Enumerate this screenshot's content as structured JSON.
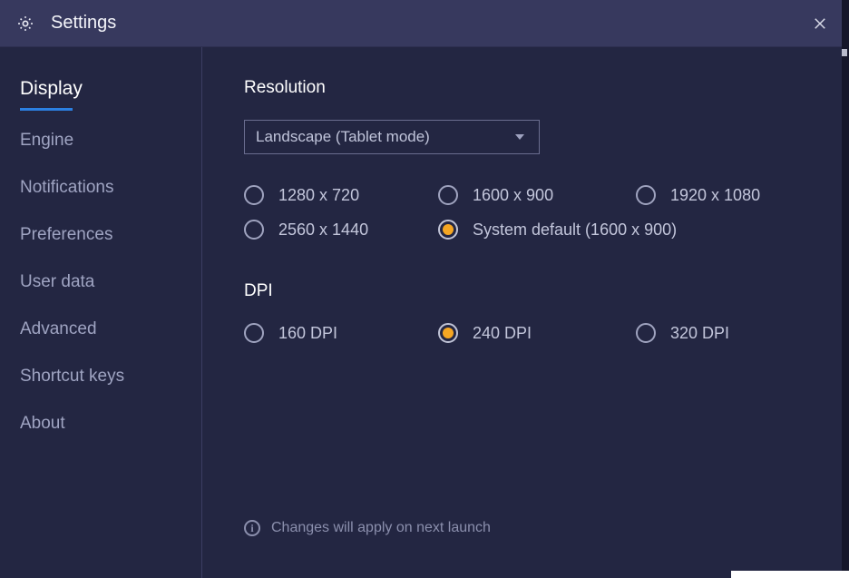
{
  "titlebar": {
    "title": "Settings"
  },
  "sidebar": {
    "items": [
      {
        "label": "Display",
        "active": true
      },
      {
        "label": "Engine",
        "active": false
      },
      {
        "label": "Notifications",
        "active": false
      },
      {
        "label": "Preferences",
        "active": false
      },
      {
        "label": "User data",
        "active": false
      },
      {
        "label": "Advanced",
        "active": false
      },
      {
        "label": "Shortcut keys",
        "active": false
      },
      {
        "label": "About",
        "active": false
      }
    ]
  },
  "main": {
    "resolution": {
      "title": "Resolution",
      "dropdown": {
        "selected": "Landscape (Tablet mode)"
      },
      "options": [
        {
          "label": "1280 x 720",
          "selected": false
        },
        {
          "label": "1600 x 900",
          "selected": false
        },
        {
          "label": "1920 x 1080",
          "selected": false
        },
        {
          "label": "2560 x 1440",
          "selected": false
        },
        {
          "label": "System default (1600 x 900)",
          "selected": true
        }
      ]
    },
    "dpi": {
      "title": "DPI",
      "options": [
        {
          "label": "160 DPI",
          "selected": false
        },
        {
          "label": "240 DPI",
          "selected": true
        },
        {
          "label": "320 DPI",
          "selected": false
        }
      ]
    },
    "notice": "Changes will apply on next launch"
  },
  "icons": {
    "gear": "gear-icon",
    "close": "close-icon",
    "chevron_down": "chevron-down-icon",
    "info": "info-icon"
  }
}
